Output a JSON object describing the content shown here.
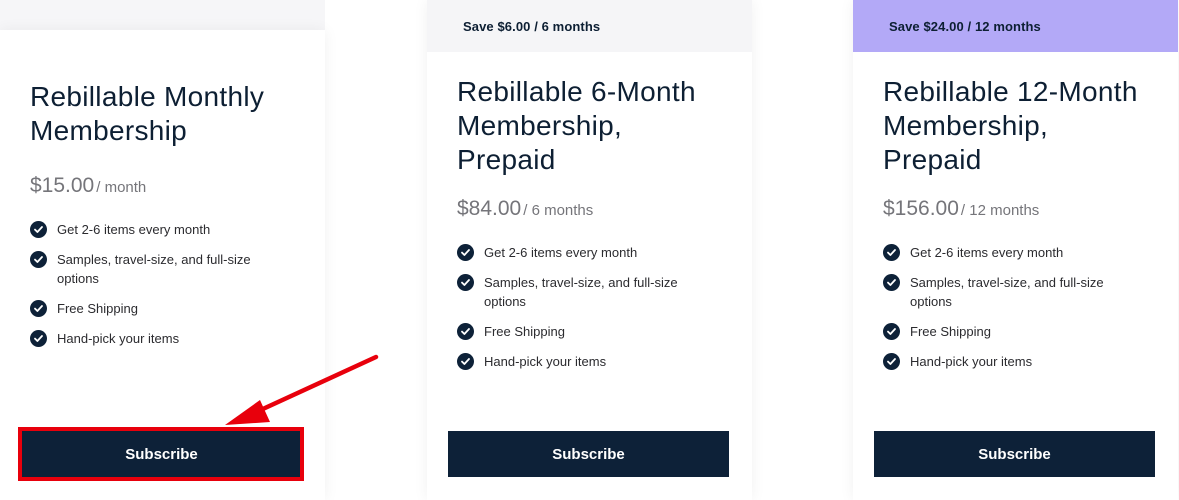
{
  "plans": [
    {
      "banner": "",
      "title": "Rebillable Monthly Membership",
      "price": "$15.00",
      "period": "/ month",
      "features": [
        "Get 2-6 items every month",
        "Samples, travel-size, and full-size options",
        "Free Shipping",
        "Hand-pick your items"
      ],
      "button_label": "Subscribe"
    },
    {
      "banner": "Save $6.00 / 6 months",
      "title": "Rebillable 6-Month Membership, Prepaid",
      "price": "$84.00",
      "period": "/ 6 months",
      "features": [
        "Get 2-6 items every month",
        "Samples, travel-size, and full-size options",
        "Free Shipping",
        "Hand-pick your items"
      ],
      "button_label": "Subscribe"
    },
    {
      "banner": "Save $24.00 / 12 months",
      "title": "Rebillable 12-Month Membership, Prepaid",
      "price": "$156.00",
      "period": "/ 12 months",
      "features": [
        "Get 2-6 items every month",
        "Samples, travel-size, and full-size options",
        "Free Shipping",
        "Hand-pick your items"
      ],
      "button_label": "Subscribe"
    }
  ],
  "colors": {
    "navy": "#0d2138",
    "banner_grey": "#f5f5f7",
    "banner_purple": "#b3a9f7",
    "highlight_red": "#e8000c",
    "price_grey": "#75757a"
  },
  "icons": {
    "feature": "check-circle-icon",
    "annotation": "red-arrow"
  }
}
